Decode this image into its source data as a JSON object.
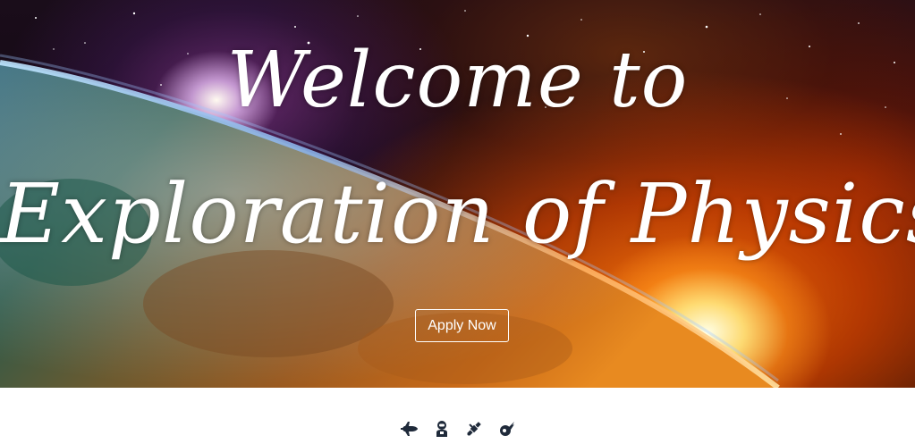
{
  "hero": {
    "title_line1": "Welcome to",
    "title_line2": "Exploration of Physics",
    "apply_label": "Apply Now"
  },
  "icons": [
    "space-shuttle-icon",
    "astronaut-icon",
    "satellite-icon",
    "meteor-icon"
  ],
  "colors": {
    "text": "#ffffff",
    "icon": "#1f2a3a",
    "sun": "#ff8a1a",
    "background": "#ffffff"
  }
}
